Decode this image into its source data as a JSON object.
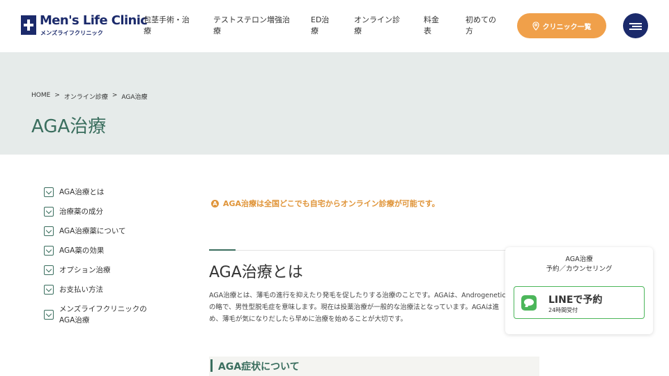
{
  "header": {
    "logo_title": "Men's Life Clinic",
    "logo_subtitle": "メンズライフクリニック",
    "nav": [
      {
        "line1": "包茎手術・治",
        "line2": "療"
      },
      {
        "line1": "テストステロン増強治",
        "line2": "療"
      },
      {
        "line1": "ED治",
        "line2": "療"
      },
      {
        "line1": "オンライン診",
        "line2": "療"
      },
      {
        "line1": "料金",
        "line2": "表"
      },
      {
        "line1": "初めての",
        "line2": "方"
      }
    ],
    "clinic_button": "クリニック一覧",
    "menu_icon": "hamburger-icon"
  },
  "hero": {
    "breadcrumb": [
      "HOME",
      ">",
      "オンライン診療",
      ">",
      "AGA治療"
    ],
    "title": "AGA治療"
  },
  "toc": [
    {
      "label": "AGA治療とは"
    },
    {
      "label": "治療薬の成分"
    },
    {
      "label": "AGA治療薬について"
    },
    {
      "label": "AGA薬の効果"
    },
    {
      "label": "オプション治療"
    },
    {
      "label": "お支払い方法"
    },
    {
      "label": "メンズライフクリニックの",
      "label2": "AGA治療"
    }
  ],
  "main": {
    "notice": "AGA治療は全国どこでも自宅からオンライン診療が可能です。",
    "section_title": "AGA治療とは",
    "body_lines": [
      "AGA治療とは、薄毛の進行を抑えたり発毛を促したりする治療のことです。AGAは、Androgenetic",
      "の略で、男性型脱毛症を意味します。現在は投薬治療が一般的な治療法となっています。AGAは進",
      "め、薄毛が気になりだしたら早めに治療を始めることが大切です。"
    ],
    "sub_heading": "AGA症状について"
  },
  "float_card": {
    "title_line1": "AGA治療",
    "title_line2": "予約／カウンセリング",
    "line_button_label": "LINEで予約",
    "line_button_sub": "24時間受付"
  },
  "colors": {
    "brand_navy": "#1b2a6b",
    "accent_orange": "#f0a04a",
    "green": "#3a6e5e",
    "line_green": "#4cb65a",
    "hero_bg": "#e6ebea"
  }
}
